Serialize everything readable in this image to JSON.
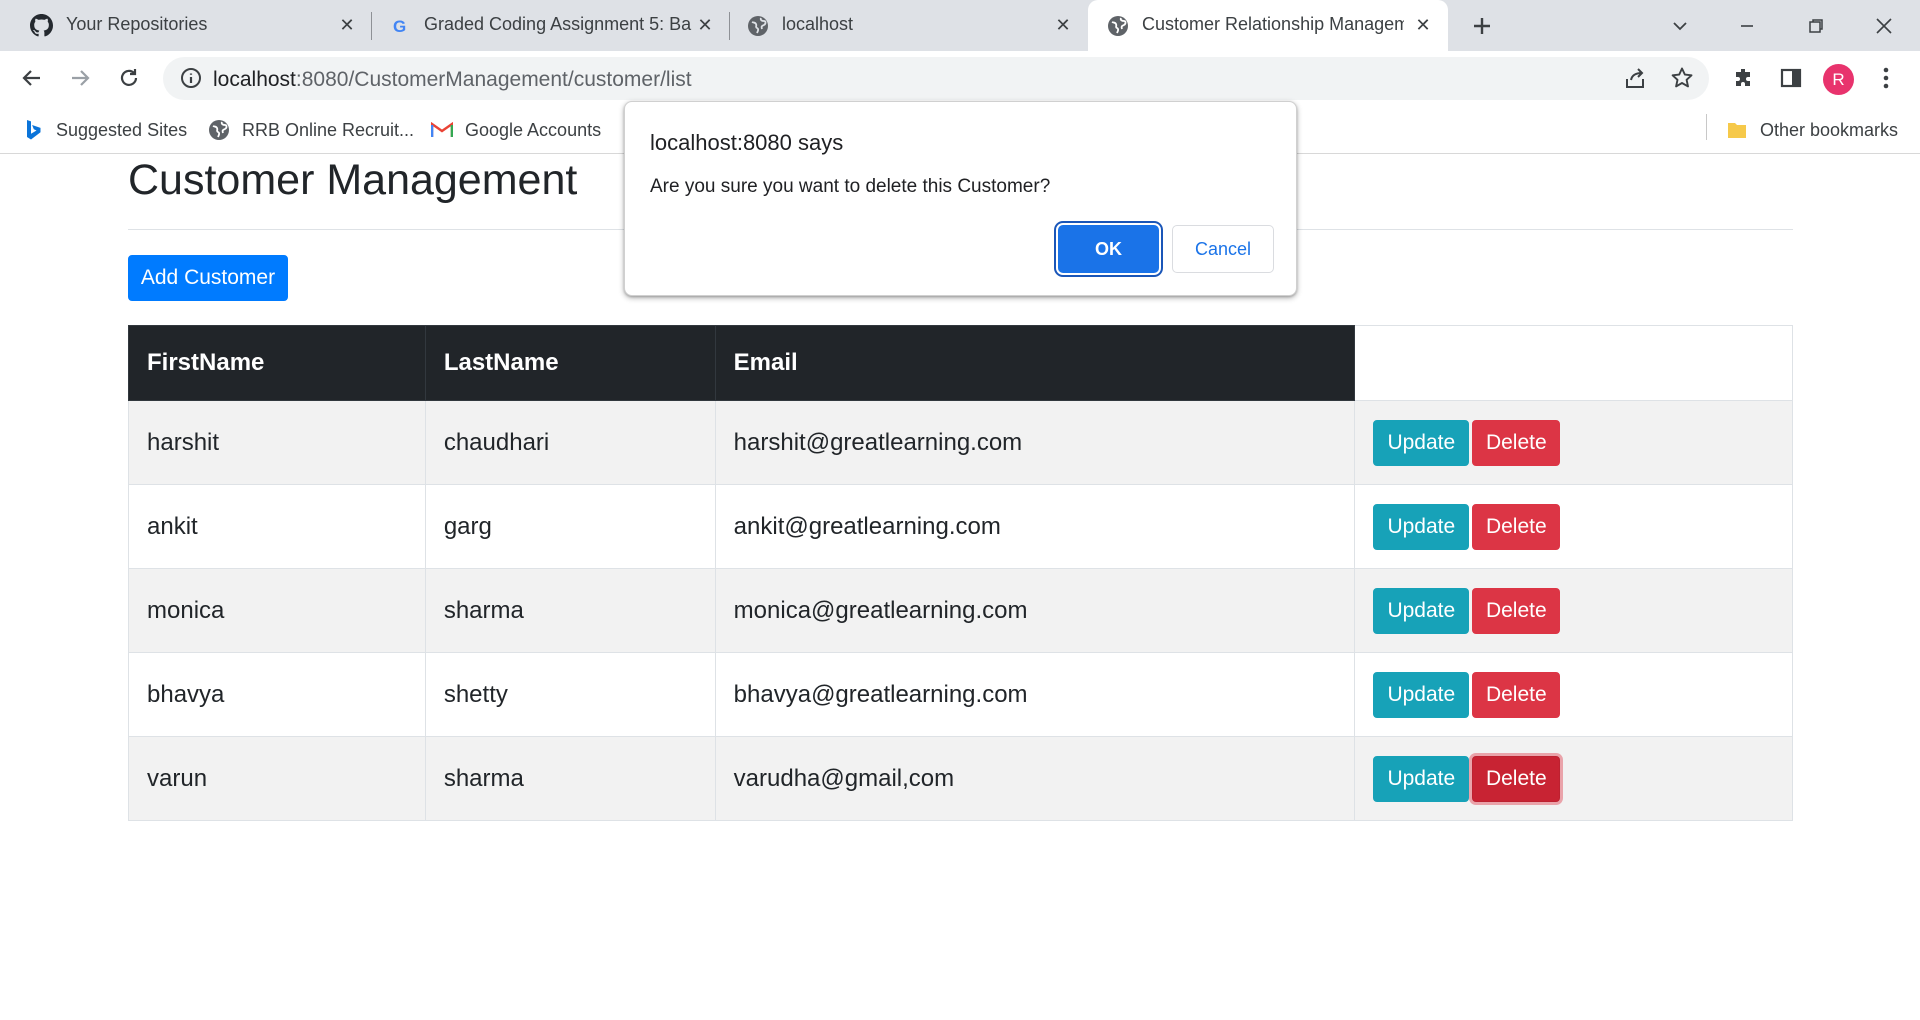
{
  "browser": {
    "tabs": [
      {
        "title": "Your Repositories",
        "icon": "github-icon"
      },
      {
        "title": "Graded Coding Assignment 5: Ba",
        "icon": "google-icon"
      },
      {
        "title": "localhost",
        "icon": "globe-icon"
      },
      {
        "title": "Customer Relationship Managem",
        "icon": "globe-icon",
        "active": true
      }
    ],
    "url_host": "localhost",
    "url_path": ":8080/CustomerManagement/customer/list",
    "avatar_letter": "R",
    "bookmarks": [
      {
        "label": "Suggested Sites",
        "icon": "bing-icon"
      },
      {
        "label": "RRB Online Recruit...",
        "icon": "globe-icon"
      },
      {
        "label": "Google Accounts",
        "icon": "gmail-icon"
      }
    ],
    "other_bookmarks": "Other bookmarks"
  },
  "page": {
    "title": "Customer Management",
    "add_button": "Add Customer",
    "columns": [
      "FirstName",
      "LastName",
      "Email"
    ],
    "rows": [
      {
        "first": "harshit",
        "last": "chaudhari",
        "email": "harshit@greatlearning.com"
      },
      {
        "first": "ankit",
        "last": "garg",
        "email": "ankit@greatlearning.com"
      },
      {
        "first": "monica",
        "last": "sharma",
        "email": "monica@greatlearning.com"
      },
      {
        "first": "bhavya",
        "last": "shetty",
        "email": "bhavya@greatlearning.com"
      },
      {
        "first": "varun",
        "last": "sharma",
        "email": "varudha@gmail,com"
      }
    ],
    "update_label": "Update",
    "delete_label": "Delete"
  },
  "dialog": {
    "title": "localhost:8080 says",
    "message": "Are you sure you want to delete this Customer?",
    "ok": "OK",
    "cancel": "Cancel"
  },
  "colors": {
    "primary": "#007bff",
    "info": "#17a2b8",
    "danger": "#dc3545",
    "dark": "#212529",
    "dialog_blue": "#1a73e8"
  }
}
